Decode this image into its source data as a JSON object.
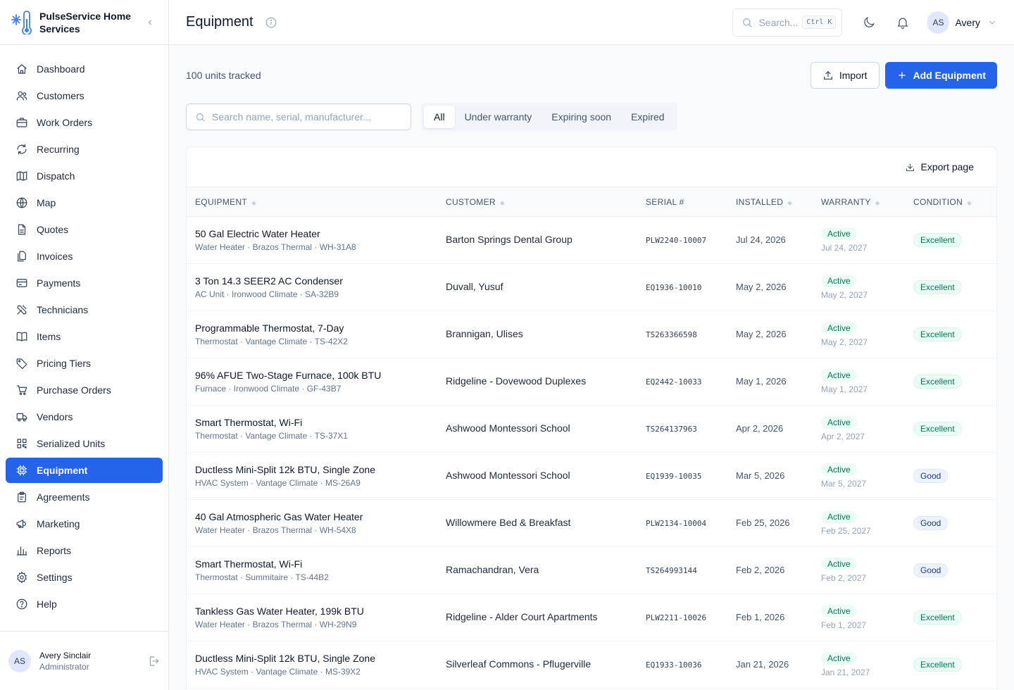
{
  "brand": {
    "name": "PulseService Home Services",
    "logo_icon": "thermometer-snowflake-icon"
  },
  "sidebar": {
    "items": [
      {
        "label": "Dashboard",
        "icon": "home-icon",
        "active": false
      },
      {
        "label": "Customers",
        "icon": "users-icon",
        "active": false
      },
      {
        "label": "Work Orders",
        "icon": "briefcase-icon",
        "active": false
      },
      {
        "label": "Recurring",
        "icon": "refresh-icon",
        "active": false
      },
      {
        "label": "Dispatch",
        "icon": "map-fold-icon",
        "active": false
      },
      {
        "label": "Map",
        "icon": "globe-icon",
        "active": false
      },
      {
        "label": "Quotes",
        "icon": "document-icon",
        "active": false
      },
      {
        "label": "Invoices",
        "icon": "files-icon",
        "active": false
      },
      {
        "label": "Payments",
        "icon": "credit-card-icon",
        "active": false
      },
      {
        "label": "Technicians",
        "icon": "wrench-icon",
        "active": false
      },
      {
        "label": "Items",
        "icon": "book-icon",
        "active": false
      },
      {
        "label": "Pricing Tiers",
        "icon": "tag-icon",
        "active": false
      },
      {
        "label": "Purchase Orders",
        "icon": "cart-icon",
        "active": false
      },
      {
        "label": "Vendors",
        "icon": "truck-icon",
        "active": false
      },
      {
        "label": "Serialized Units",
        "icon": "qr-code-icon",
        "active": false
      },
      {
        "label": "Equipment",
        "icon": "cpu-icon",
        "active": true
      },
      {
        "label": "Agreements",
        "icon": "clipboard-icon",
        "active": false
      },
      {
        "label": "Marketing",
        "icon": "megaphone-icon",
        "active": false
      },
      {
        "label": "Reports",
        "icon": "bar-chart-icon",
        "active": false
      },
      {
        "label": "Settings",
        "icon": "gear-icon",
        "active": false
      },
      {
        "label": "Help",
        "icon": "help-circle-icon",
        "active": false
      }
    ],
    "user": {
      "initials": "AS",
      "name": "Avery Sinclair",
      "role": "Administrator"
    }
  },
  "header": {
    "title": "Equipment",
    "search_placeholder": "Search...",
    "shortcut": "Ctrl K",
    "account_initials": "AS",
    "account_name": "Avery"
  },
  "toolbar": {
    "count_text": "100 units tracked",
    "import_label": "Import",
    "add_label": "Add Equipment"
  },
  "filters": {
    "search_placeholder": "Search name, serial, manufacturer...",
    "tabs": [
      "All",
      "Under warranty",
      "Expiring soon",
      "Expired"
    ],
    "active_tab": "All"
  },
  "table": {
    "export_label": "Export page",
    "columns": [
      "EQUIPMENT",
      "CUSTOMER",
      "SERIAL #",
      "INSTALLED",
      "WARRANTY",
      "CONDITION"
    ],
    "rows": [
      {
        "name": "50 Gal Electric Water Heater",
        "sub": "Water Heater · Brazos Thermal · WH-31A8",
        "customer": "Barton Springs Dental Group",
        "serial": "PLW2240-10007",
        "installed": "Jul 24, 2026",
        "warranty_status": "Active",
        "warranty_expires": "Jul 24, 2027",
        "condition": "Excellent"
      },
      {
        "name": "3 Ton 14.3 SEER2 AC Condenser",
        "sub": "AC Unit · Ironwood Climate · SA-32B9",
        "customer": "Duvall, Yusuf",
        "serial": "EQ1936-10010",
        "installed": "May 2, 2026",
        "warranty_status": "Active",
        "warranty_expires": "May 2, 2027",
        "condition": "Excellent"
      },
      {
        "name": "Programmable Thermostat, 7-Day",
        "sub": "Thermostat · Vantage Climate · TS-42X2",
        "customer": "Brannigan, Ulises",
        "serial": "TS263366598",
        "installed": "May 2, 2026",
        "warranty_status": "Active",
        "warranty_expires": "May 2, 2027",
        "condition": "Excellent"
      },
      {
        "name": "96% AFUE Two-Stage Furnace, 100k BTU",
        "sub": "Furnace · Ironwood Climate · GF-43B7",
        "customer": "Ridgeline - Dovewood Duplexes",
        "serial": "EQ2442-10033",
        "installed": "May 1, 2026",
        "warranty_status": "Active",
        "warranty_expires": "May 1, 2027",
        "condition": "Excellent"
      },
      {
        "name": "Smart Thermostat, Wi-Fi",
        "sub": "Thermostat · Vantage Climate · TS-37X1",
        "customer": "Ashwood Montessori School",
        "serial": "TS264137963",
        "installed": "Apr 2, 2026",
        "warranty_status": "Active",
        "warranty_expires": "Apr 2, 2027",
        "condition": "Excellent"
      },
      {
        "name": "Ductless Mini-Split 12k BTU, Single Zone",
        "sub": "HVAC System · Vantage Climate · MS-26A9",
        "customer": "Ashwood Montessori School",
        "serial": "EQ1939-10035",
        "installed": "Mar 5, 2026",
        "warranty_status": "Active",
        "warranty_expires": "Mar 5, 2027",
        "condition": "Good"
      },
      {
        "name": "40 Gal Atmospheric Gas Water Heater",
        "sub": "Water Heater · Brazos Thermal · WH-54X8",
        "customer": "Willowmere Bed & Breakfast",
        "serial": "PLW2134-10004",
        "installed": "Feb 25, 2026",
        "warranty_status": "Active",
        "warranty_expires": "Feb 25, 2027",
        "condition": "Good"
      },
      {
        "name": "Smart Thermostat, Wi-Fi",
        "sub": "Thermostat · Summitaire · TS-44B2",
        "customer": "Ramachandran, Vera",
        "serial": "TS264993144",
        "installed": "Feb 2, 2026",
        "warranty_status": "Active",
        "warranty_expires": "Feb 2, 2027",
        "condition": "Good"
      },
      {
        "name": "Tankless Gas Water Heater, 199k BTU",
        "sub": "Water Heater · Brazos Thermal · WH-29N9",
        "customer": "Ridgeline - Alder Court Apartments",
        "serial": "PLW2211-10026",
        "installed": "Feb 1, 2026",
        "warranty_status": "Active",
        "warranty_expires": "Feb 1, 2027",
        "condition": "Excellent"
      },
      {
        "name": "Ductless Mini-Split 12k BTU, Single Zone",
        "sub": "HVAC System · Vantage Climate · MS-39X2",
        "customer": "Silverleaf Commons - Pflugerville",
        "serial": "EQ1933-10036",
        "installed": "Jan 21, 2026",
        "warranty_status": "Active",
        "warranty_expires": "Jan 21, 2027",
        "condition": "Excellent"
      }
    ]
  },
  "colors": {
    "accent": "#2563eb",
    "active_badge_bg": "#ecfdf5",
    "active_badge_text": "#047857",
    "good_badge_bg": "#eef2ff"
  }
}
